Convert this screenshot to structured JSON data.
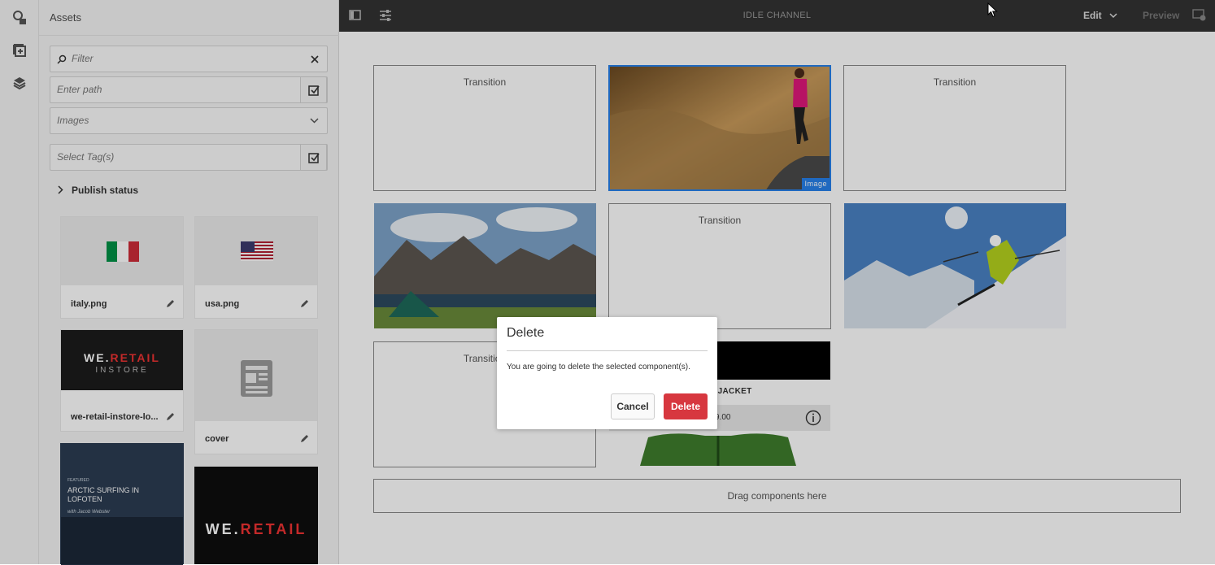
{
  "panel": {
    "title": "Assets",
    "filter_placeholder": "Filter",
    "path_placeholder": "Enter path",
    "asset_type": "Images",
    "tags_placeholder": "Select Tag(s)",
    "publish_status": "Publish status"
  },
  "assets": [
    {
      "name": "italy.png",
      "icon": "italy-flag"
    },
    {
      "name": "usa.png",
      "icon": "usa-flag"
    },
    {
      "name": "we-retail-instore-lo...",
      "logo_text_1": "WE.",
      "logo_text_2": "RETAIL",
      "logo_text_3": "INSTORE"
    },
    {
      "name": "cover",
      "icon": "document-icon"
    },
    {
      "name": "",
      "featured": "FEATURED",
      "headline": "ARCTIC SURFING IN LOFOTEN",
      "byline": "with Jacob Webster"
    },
    {
      "name": "",
      "logo_text_1": "WE.",
      "logo_text_2": "RETAIL"
    }
  ],
  "topbar": {
    "channel": "IDLE CHANNEL",
    "mode": "Edit",
    "preview": "Preview"
  },
  "canvas": {
    "transition_label": "Transition",
    "image_badge": "Image",
    "product_name": "LATED JACKET",
    "product_price": "9.00",
    "drag_hint": "Drag components here"
  },
  "dialog": {
    "title": "Delete",
    "message": "You are going to delete the selected component(s).",
    "cancel": "Cancel",
    "delete": "Delete"
  },
  "colors": {
    "accent_red": "#d7373f",
    "topbar": "#333333",
    "selection": "#2680eb"
  }
}
